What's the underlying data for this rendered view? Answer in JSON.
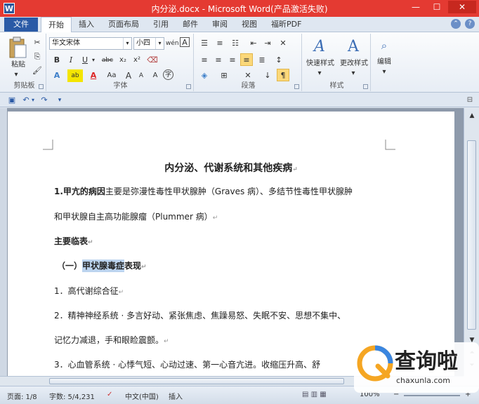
{
  "window": {
    "title": "内分泌.docx - Microsoft Word(产品激活失败)",
    "app_badge": "W",
    "minimize": "—",
    "maximize": "☐",
    "close": "✕"
  },
  "tabs": {
    "file": "文件",
    "items": [
      "开始",
      "插入",
      "页面布局",
      "引用",
      "邮件",
      "审阅",
      "视图",
      "福昕PDF"
    ],
    "active": "开始",
    "help": "?"
  },
  "ribbon": {
    "clipboard": {
      "label": "剪贴板",
      "paste": "粘贴"
    },
    "font": {
      "label": "字体",
      "font_name": "华文宋体",
      "font_size": "小四",
      "wen": "wén",
      "a_box": "A",
      "bold": "B",
      "italic": "I",
      "underline": "U",
      "strike": "abc",
      "subscript": "x₂",
      "superscript": "x²",
      "grow": "A",
      "shrink": "A",
      "aa": "Aa",
      "highlight": "ab",
      "font_color": "A",
      "circled": "字"
    },
    "paragraph": {
      "label": "段落"
    },
    "styles": {
      "label": "样式",
      "quick": "快速样式",
      "change": "更改样式"
    },
    "editing": {
      "label": "编辑"
    }
  },
  "document": {
    "title": "内分泌、代谢系统和其他疾病",
    "line1_bold": "1.甲亢的病因",
    "line1_rest": "主要是弥漫性毒性甲状腺肿（Graves 病）、多结节性毒性甲状腺肿",
    "line2": "和甲状腺自主高功能腺瘤（Plummer 病）",
    "heading_main": "主要临表",
    "heading_sub_prefix": "（一）",
    "heading_sub_selected": "甲状腺毒症",
    "heading_sub_rest": "表现",
    "item1": "1．高代谢综合征",
    "item2a": "2．精神神经系统 · 多言好动、紧张焦虑、焦躁易怒、失眠不安、思想不集中、",
    "item2b": "记忆力减退，手和眼睑震颤。",
    "item3": "3．心血管系统 · 心悸气短、心动过速、第一心音亢进。收缩压升高、舒",
    "para_mark": "↵"
  },
  "statusbar": {
    "page": "页面: 1/8",
    "words": "字数: 5/4,231",
    "language": "中文(中国)",
    "mode": "插入",
    "zoom": "100%"
  },
  "watermark": {
    "brand": "查询啦",
    "url": "chaxunla.com"
  },
  "colors": {
    "titlebar": "#e43a32",
    "file_tab": "#2a5aa6",
    "selection": "#bcd4ef"
  }
}
